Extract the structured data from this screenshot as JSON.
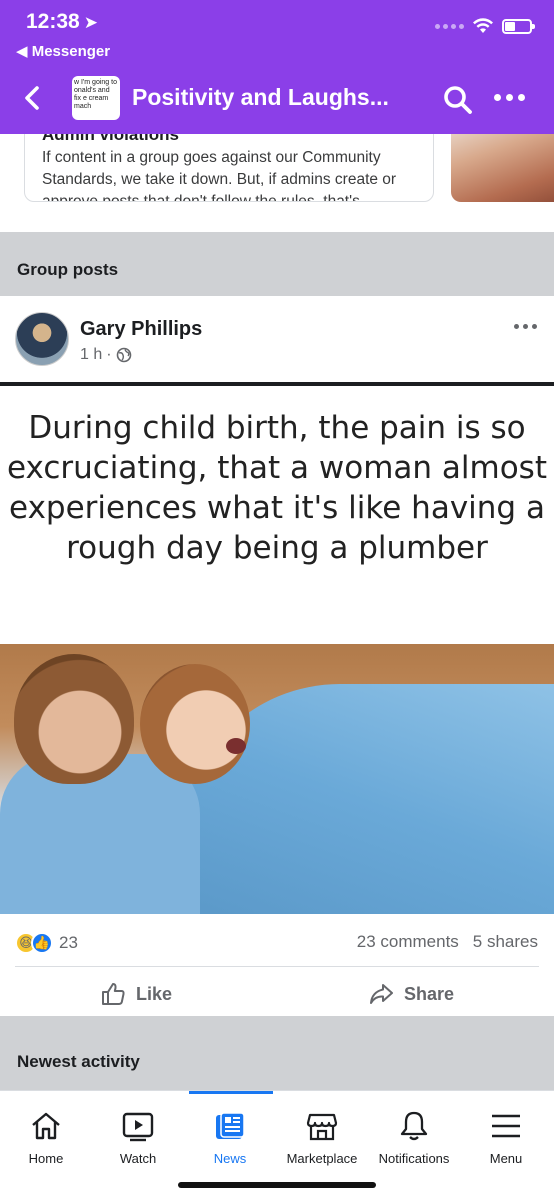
{
  "status_bar": {
    "time": "12:38",
    "back_app": "◀ Messenger"
  },
  "header": {
    "group_name": "Positivity and Laughs...",
    "thumb_text": "w I'm going to onald's and fix e cream mach"
  },
  "suggested_card": {
    "title": "Admin violations",
    "body": "If content in a group goes against our Community Standards, we take it down. But, if admins create or approve posts that don't follow the rules, that's"
  },
  "sections": {
    "group_posts": "Group posts",
    "newest_activity": "Newest activity"
  },
  "post": {
    "author": "Gary Phillips",
    "time": "1 h",
    "separator": "·",
    "meme_text": "During child birth, the pain is so excruciating, that a woman almost experiences what it's like having a rough day being a plumber",
    "reaction_count": "23",
    "comments": "23 comments",
    "shares": "5 shares",
    "like_label": "Like",
    "share_label": "Share"
  },
  "tabbar": {
    "active": "News",
    "tabs": [
      {
        "label": "Home",
        "icon": "home-icon"
      },
      {
        "label": "Watch",
        "icon": "watch-icon"
      },
      {
        "label": "News",
        "icon": "news-icon"
      },
      {
        "label": "Marketplace",
        "icon": "marketplace-icon"
      },
      {
        "label": "Notifications",
        "icon": "bell-icon"
      },
      {
        "label": "Menu",
        "icon": "menu-icon"
      }
    ]
  },
  "colors": {
    "header_bg": "#8b3fe8",
    "accent": "#1877f2",
    "section_bg": "#cfd1d4"
  }
}
